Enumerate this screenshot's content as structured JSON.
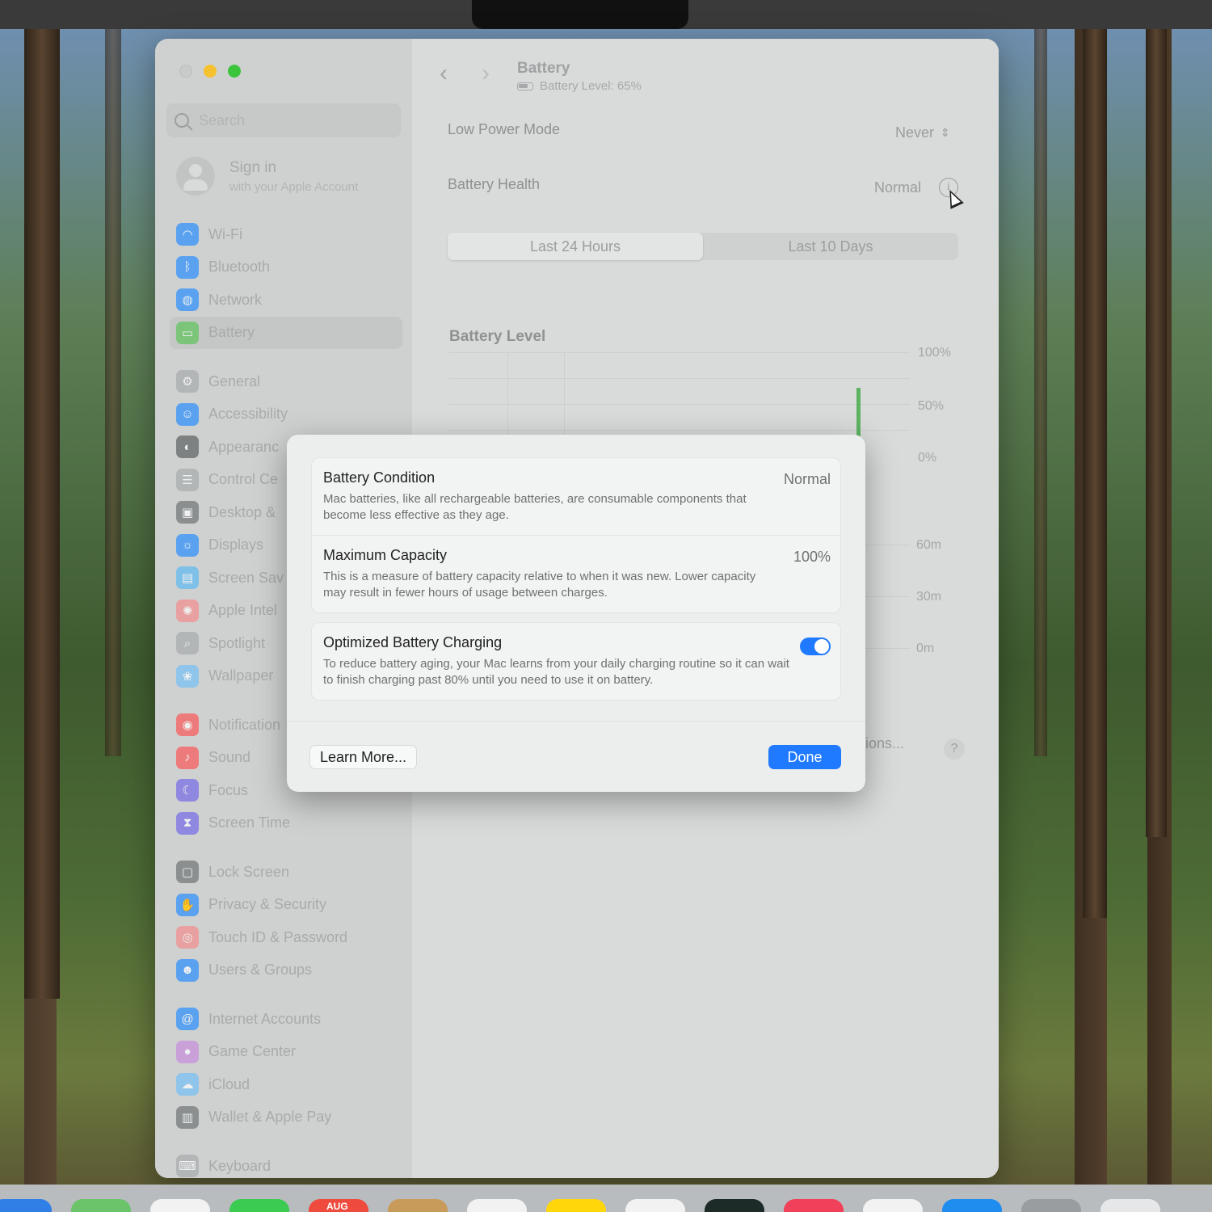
{
  "window": {
    "sidebar": {
      "search_placeholder": "Search",
      "account": {
        "name": "Sign in",
        "subtitle": "with your Apple Account"
      },
      "items": [
        {
          "label": "Wi-Fi",
          "icon": "wifi-icon",
          "color": "#5aa2f0"
        },
        {
          "label": "Bluetooth",
          "icon": "bluetooth-icon",
          "color": "#5aa2f0"
        },
        {
          "label": "Network",
          "icon": "globe-icon",
          "color": "#5aa2f0"
        },
        {
          "label": "Battery",
          "icon": "battery-icon",
          "color": "#7bc47a",
          "active": true
        },
        {
          "label": "General",
          "icon": "gear-icon",
          "color": "#b3b6b7"
        },
        {
          "label": "Accessibility",
          "icon": "accessibility-icon",
          "color": "#5aa2f0"
        },
        {
          "label": "Appearanc",
          "icon": "appearance-icon",
          "color": "#7e8182"
        },
        {
          "label": "Control Ce",
          "icon": "control-center-icon",
          "color": "#b3b6b7"
        },
        {
          "label": "Desktop &",
          "icon": "desktop-icon",
          "color": "#8c8f90"
        },
        {
          "label": "Displays",
          "icon": "displays-icon",
          "color": "#5aa2f0"
        },
        {
          "label": "Screen Sav",
          "icon": "screen-saver-icon",
          "color": "#7fc0e8"
        },
        {
          "label": "Apple Intel",
          "icon": "apple-intelligence-icon",
          "color": "#e8a0a0"
        },
        {
          "label": "Spotlight",
          "icon": "spotlight-icon",
          "color": "#b3b6b7"
        },
        {
          "label": "Wallpaper",
          "icon": "wallpaper-icon",
          "color": "#8fc5ea"
        },
        {
          "label": "Notification",
          "icon": "notifications-icon",
          "color": "#ee7b7b"
        },
        {
          "label": "Sound",
          "icon": "sound-icon",
          "color": "#ee7b7b"
        },
        {
          "label": "Focus",
          "icon": "focus-icon",
          "color": "#8f88e0"
        },
        {
          "label": "Screen Time",
          "icon": "screen-time-icon",
          "color": "#8f88e0"
        },
        {
          "label": "Lock Screen",
          "icon": "lock-icon",
          "color": "#8c8f90"
        },
        {
          "label": "Privacy & Security",
          "icon": "hand-icon",
          "color": "#5aa2f0"
        },
        {
          "label": "Touch ID & Password",
          "icon": "fingerprint-icon",
          "color": "#e8a0a0"
        },
        {
          "label": "Users & Groups",
          "icon": "users-icon",
          "color": "#5aa2f0"
        },
        {
          "label": "Internet Accounts",
          "icon": "at-icon",
          "color": "#5aa2f0"
        },
        {
          "label": "Game Center",
          "icon": "game-center-icon",
          "color": "#c9a0d8"
        },
        {
          "label": "iCloud",
          "icon": "icloud-icon",
          "color": "#8fc5ea"
        },
        {
          "label": "Wallet & Apple Pay",
          "icon": "wallet-icon",
          "color": "#8c8f90"
        },
        {
          "label": "Keyboard",
          "icon": "keyboard-icon",
          "color": "#b3b6b7"
        }
      ]
    },
    "content": {
      "title": "Battery",
      "subtitle": "Battery Level: 65%",
      "low_power_mode": {
        "label": "Low Power Mode",
        "value": "Never"
      },
      "battery_health": {
        "label": "Battery Health",
        "value": "Normal"
      },
      "tabs": [
        {
          "label": "Last 24 Hours",
          "selected": true
        },
        {
          "label": "Last 10 Days",
          "selected": false
        }
      ],
      "chart_title": "Battery Level",
      "level_axis": [
        "100%",
        "50%",
        "0%"
      ],
      "usage_axis": [
        "60m",
        "30m",
        "0m"
      ],
      "options_label": "ptions...",
      "help_label": "?"
    }
  },
  "sheet": {
    "battery_condition": {
      "title": "Battery Condition",
      "value": "Normal",
      "description": "Mac batteries, like all rechargeable batteries, are consumable components that become less effective as they age."
    },
    "maximum_capacity": {
      "title": "Maximum Capacity",
      "value": "100%",
      "description": "This is a measure of battery capacity relative to when it was new. Lower capacity may result in fewer hours of usage between charges."
    },
    "optimized_charging": {
      "title": "Optimized Battery Charging",
      "enabled": true,
      "description": "To reduce battery aging, your Mac learns from your daily charging routine so it can wait to finish charging past 80% until you need to use it on battery."
    },
    "learn_more_label": "Learn More...",
    "done_label": "Done"
  },
  "dock": {
    "calendar_month": "AUG",
    "apps": [
      {
        "name": "finder-icon",
        "color": "#2f7fe6"
      },
      {
        "name": "maps-icon",
        "color": "#6cc46a"
      },
      {
        "name": "photos-icon",
        "color": "#f2f2f2"
      },
      {
        "name": "messages-icon",
        "color": "#3ccb52"
      },
      {
        "name": "calendar-icon",
        "color": "#ee4b3e"
      },
      {
        "name": "notes-icon",
        "color": "#c89b5a"
      },
      {
        "name": "reminders-icon",
        "color": "#f2f2f2"
      },
      {
        "name": "stickies-icon",
        "color": "#ffd60a"
      },
      {
        "name": "freeform-icon",
        "color": "#f2f2f2"
      },
      {
        "name": "terminal-icon",
        "color": "#1c2a28"
      },
      {
        "name": "music-icon",
        "color": "#f0405a"
      },
      {
        "name": "preview-icon",
        "color": "#f2f2f2"
      },
      {
        "name": "app-store-icon",
        "color": "#1f8cf0"
      },
      {
        "name": "system-settings-icon",
        "color": "#9a9d9f"
      },
      {
        "name": "trash-icon",
        "color": "#e6e7e8"
      }
    ]
  }
}
